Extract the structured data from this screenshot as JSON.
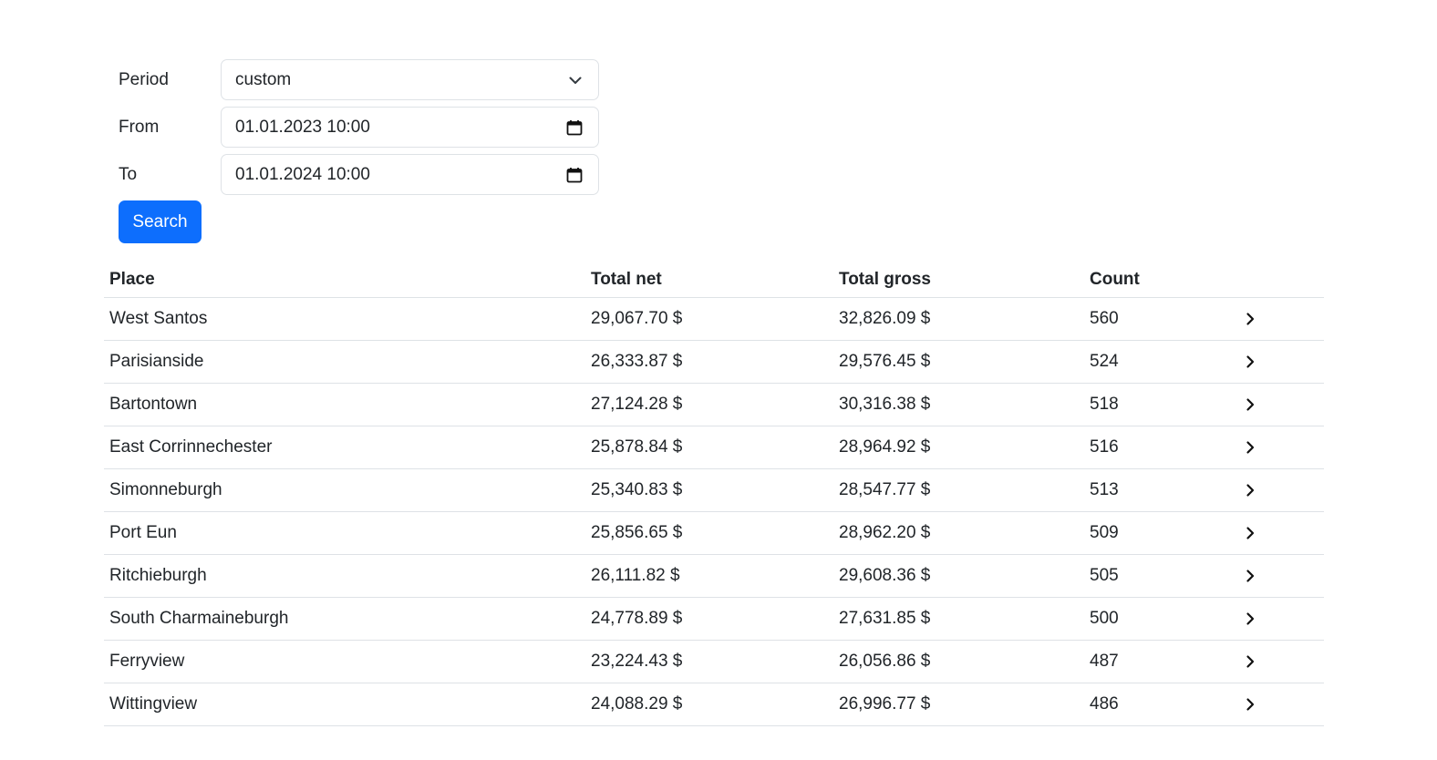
{
  "filters": {
    "period": {
      "label": "Period",
      "value": "custom"
    },
    "from": {
      "label": "From",
      "value": "01.01.2023 10:00"
    },
    "to": {
      "label": "To",
      "value": "01.01.2024 10:00"
    },
    "search_label": "Search",
    "search_color": "#0d6efd"
  },
  "table": {
    "headers": {
      "place": "Place",
      "total_net": "Total net",
      "total_gross": "Total gross",
      "count": "Count"
    },
    "rows": [
      {
        "place": "West Santos",
        "total_net": "29,067.70 $",
        "total_gross": "32,826.09 $",
        "count": "560"
      },
      {
        "place": "Parisianside",
        "total_net": "26,333.87 $",
        "total_gross": "29,576.45 $",
        "count": "524"
      },
      {
        "place": "Bartontown",
        "total_net": "27,124.28 $",
        "total_gross": "30,316.38 $",
        "count": "518"
      },
      {
        "place": "East Corrinnechester",
        "total_net": "25,878.84 $",
        "total_gross": "28,964.92 $",
        "count": "516"
      },
      {
        "place": "Simonneburgh",
        "total_net": "25,340.83 $",
        "total_gross": "28,547.77 $",
        "count": "513"
      },
      {
        "place": "Port Eun",
        "total_net": "25,856.65 $",
        "total_gross": "28,962.20 $",
        "count": "509"
      },
      {
        "place": "Ritchieburgh",
        "total_net": "26,111.82 $",
        "total_gross": "29,608.36 $",
        "count": "505"
      },
      {
        "place": "South Charmaineburgh",
        "total_net": "24,778.89 $",
        "total_gross": "27,631.85 $",
        "count": "500"
      },
      {
        "place": "Ferryview",
        "total_net": "23,224.43 $",
        "total_gross": "26,056.86 $",
        "count": "487"
      },
      {
        "place": "Wittingview",
        "total_net": "24,088.29 $",
        "total_gross": "26,996.77 $",
        "count": "486"
      }
    ],
    "row_action_icon": "chevron-right-icon"
  }
}
